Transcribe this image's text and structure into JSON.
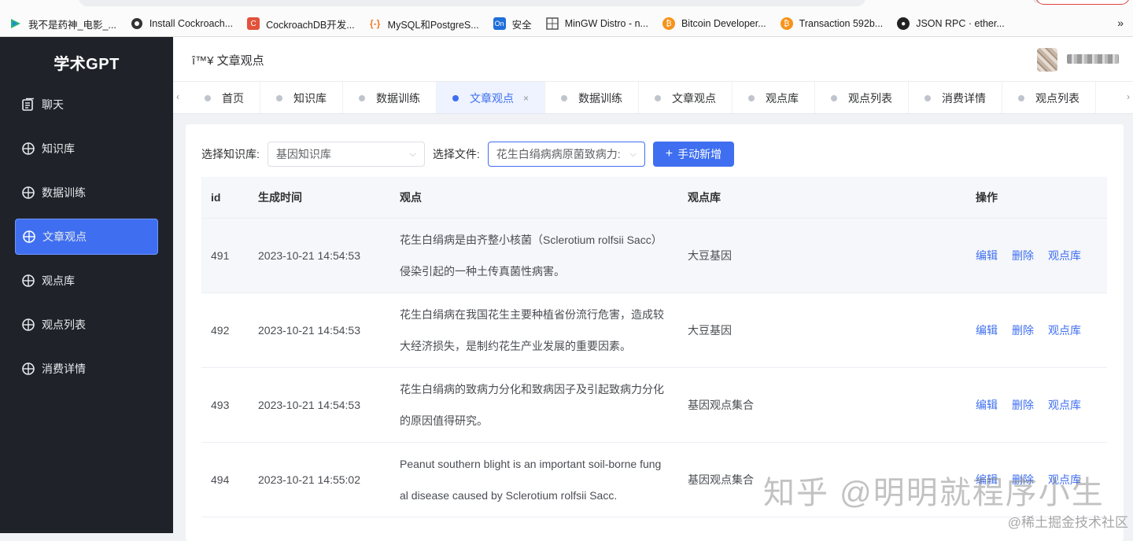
{
  "bookmarks": [
    {
      "icon": "play-icon",
      "label": "我不是药神_电影_..."
    },
    {
      "icon": "globe-icon",
      "label": "Install Cockroach..."
    },
    {
      "icon": "cockroach-icon",
      "label": "CockroachDB开发..."
    },
    {
      "icon": "code-icon",
      "label": "MySQL和PostgreS..."
    },
    {
      "icon": "on-icon",
      "label": "安全"
    },
    {
      "icon": "grid-icon",
      "label": "MinGW Distro - n..."
    },
    {
      "icon": "bitcoin-icon",
      "label": "Bitcoin Developer..."
    },
    {
      "icon": "bitcoin-icon",
      "label": "Transaction 592b..."
    },
    {
      "icon": "github-icon",
      "label": "JSON RPC · ether..."
    }
  ],
  "bookmarks_more": "»",
  "app": {
    "logo": "学术GPT"
  },
  "sidebar": {
    "items": [
      {
        "label": "聊天",
        "icon": "chat-icon",
        "active": false
      },
      {
        "label": "知识库",
        "icon": "target-icon",
        "active": false
      },
      {
        "label": "数据训练",
        "icon": "target-icon",
        "active": false
      },
      {
        "label": "文章观点",
        "icon": "target-icon",
        "active": true
      },
      {
        "label": "观点库",
        "icon": "target-icon",
        "active": false
      },
      {
        "label": "观点列表",
        "icon": "target-icon",
        "active": false
      },
      {
        "label": "消费详情",
        "icon": "target-icon",
        "active": false
      }
    ]
  },
  "header": {
    "title": "î™¥ 文章观点"
  },
  "tabs": [
    {
      "label": "首页",
      "active": false
    },
    {
      "label": "知识库",
      "active": false
    },
    {
      "label": "数据训练",
      "active": false
    },
    {
      "label": "文章观点",
      "active": true,
      "close": "×"
    },
    {
      "label": "数据训练",
      "active": false
    },
    {
      "label": "文章观点",
      "active": false
    },
    {
      "label": "观点库",
      "active": false
    },
    {
      "label": "观点列表",
      "active": false
    },
    {
      "label": "消费详情",
      "active": false
    },
    {
      "label": "观点列表",
      "active": false
    }
  ],
  "filters": {
    "kb_label": "选择知识库:",
    "kb_value": "基因知识库",
    "file_label": "选择文件:",
    "file_value": "花生白绢病病原菌致病力:",
    "add_button": "手动新增"
  },
  "table": {
    "headers": {
      "id": "id",
      "time": "生成时间",
      "view": "观点",
      "lib": "观点库",
      "ops": "操作"
    },
    "actions": {
      "edit": "编辑",
      "delete": "删除",
      "lib": "观点库"
    },
    "rows": [
      {
        "id": "491",
        "time": "2023-10-21 14:54:53",
        "view1": "花生白绢病是由齐整小核菌（Sclerotium rolfsii Sacc）",
        "view2": "侵染引起的一种土传真菌性病害。",
        "lib": "大豆基因"
      },
      {
        "id": "492",
        "time": "2023-10-21 14:54:53",
        "view1": "花生白绢病在我国花生主要种植省份流行危害，造成较",
        "view2": "大经济损失，是制约花生产业发展的重要因素。",
        "lib": "大豆基因"
      },
      {
        "id": "493",
        "time": "2023-10-21 14:54:53",
        "view1": "花生白绢病的致病力分化和致病因子及引起致病力分化",
        "view2": "的原因值得研究。",
        "lib": "基因观点集合"
      },
      {
        "id": "494",
        "time": "2023-10-21 14:55:02",
        "view1": "Peanut southern blight is an important soil-borne fung",
        "view2": "al disease caused by Sclerotium rolfsii Sacc.",
        "lib": "基因观点集合"
      }
    ]
  },
  "watermark": {
    "main": "知乎 @明明就程序小生",
    "sub": "@稀土掘金技术社区"
  }
}
